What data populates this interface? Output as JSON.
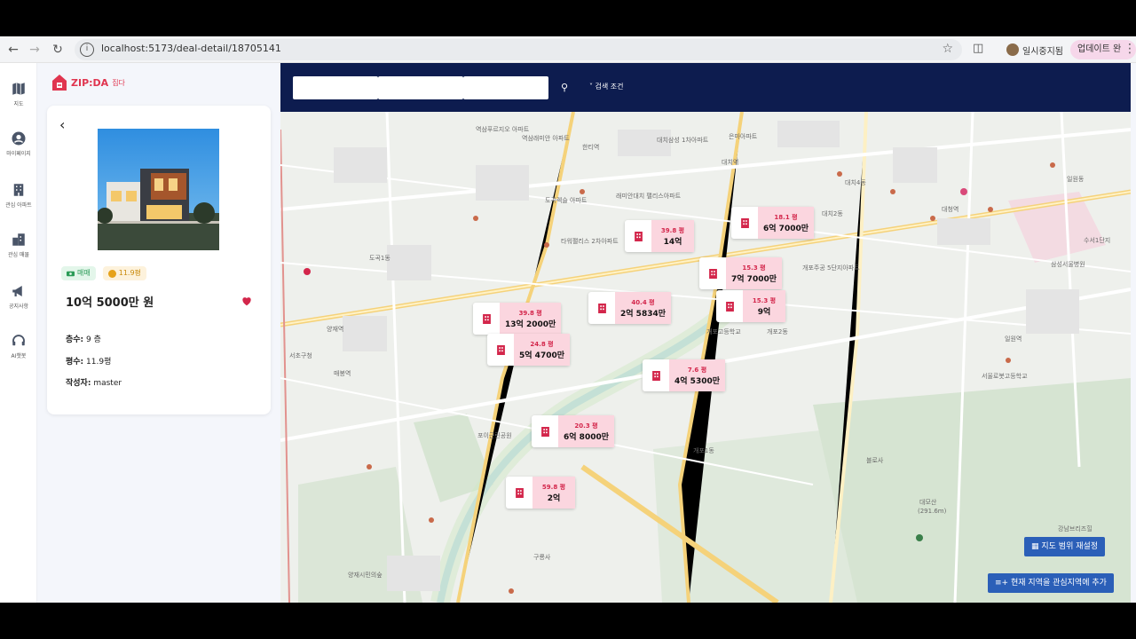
{
  "browser": {
    "url": "localhost:5173/deal-detail/18705141",
    "profile_label": "일시중지됨",
    "update_label": "업데이트 완료"
  },
  "rail": [
    {
      "label": "지도",
      "icon": "map-icon"
    },
    {
      "label": "마이페이지",
      "icon": "account-icon"
    },
    {
      "label": "관심 아파트",
      "icon": "apartment-icon"
    },
    {
      "label": "관심 매물",
      "icon": "building-icon"
    },
    {
      "label": "공지사항",
      "icon": "megaphone-icon"
    },
    {
      "label": "AI챗봇",
      "icon": "headset-icon"
    }
  ],
  "logo": {
    "text": "ZIP:DA",
    "sub": "집다"
  },
  "detail": {
    "deal_badge": "매매",
    "area_badge": "11.9평",
    "price": "10억 5000만 원",
    "floor_label": "층수:",
    "floor_value": "9 층",
    "area_label": "평수:",
    "area_value": "11.9평",
    "author_label": "작성자:",
    "author_value": "master"
  },
  "search": {
    "condition_label": "검색 조건"
  },
  "markers": [
    {
      "area": "39.8 평",
      "price": "14억"
    },
    {
      "area": "18.1 평",
      "price": "6억 7000만"
    },
    {
      "area": "15.3 평",
      "price": "7억 7000만"
    },
    {
      "area": "15.3 평",
      "price": "9억"
    },
    {
      "area": "40.4 평",
      "price": "2억 5834만"
    },
    {
      "area": "39.8 평",
      "price": "13억 2000만"
    },
    {
      "area": "24.8 평",
      "price": "5억 4700만"
    },
    {
      "area": "7.6 평",
      "price": "4억 5300만"
    },
    {
      "area": "20.3 평",
      "price": "6억 8000만"
    },
    {
      "area": "59.8 평",
      "price": "2억"
    }
  ],
  "map_buttons": {
    "reset": "지도 범위 재설정",
    "add_region": "현재 지역을 관심지역에 추가"
  },
  "places": [
    "역삼푸르지오 아파트",
    "역삼래미안 아파트",
    "한티역",
    "대치삼성 1차아파트",
    "은마아파트",
    "대치역",
    "도곡렉슬 아파트",
    "타워팰리스 2차아파트",
    "래미안대치 팰리스아파트",
    "대치2동",
    "개포주공 5단지아파트",
    "일원동",
    "양재역",
    "서초구청",
    "매봉역",
    "도곡1동",
    "개포고등학교",
    "대모산",
    "(291.6m)",
    "구룡사",
    "개포1동",
    "삼성서울병원",
    "일원역",
    "대청역",
    "양재시민의숲",
    "수서1단지",
    "대치4동",
    "개포2동",
    "포이근린공원",
    "블로사",
    "강남브리즈힐",
    "서울로봇고등학교"
  ]
}
